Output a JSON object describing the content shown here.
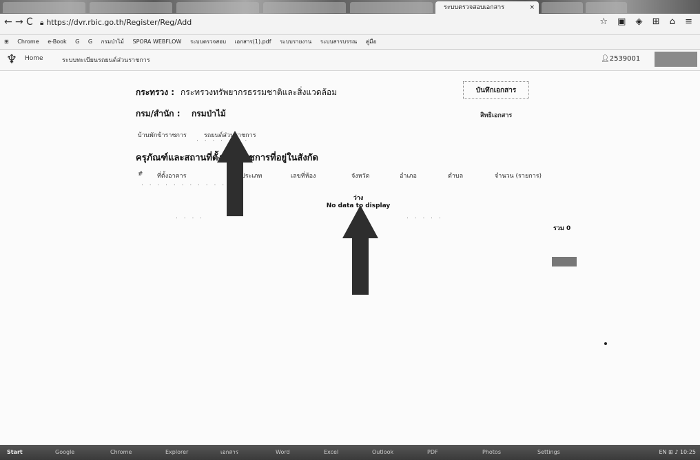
{
  "browser": {
    "active_tab_title": "ระบบตรวจสอบเอกสาร",
    "tab_close": "×",
    "url": "https://dvr.rbic.go.th/Register/Reg/Add",
    "bookmarks": [
      "Chrome",
      "e-Book",
      "G",
      "G",
      "กรมป่าไม้",
      "SPORA WEBFLOW",
      "ระบบตรวจสอบ",
      "เอกสาร(1).pdf",
      "ระบบรายงาน",
      "ระบบสารบรรณ",
      "คู่มือ"
    ],
    "ext_icons": "☆ ▣ ◈ ⊞ ⌂ ≡"
  },
  "header": {
    "home": "Home",
    "system_title": "ระบบทะเบียนรถยนต์ส่วนราชการ",
    "user_id": "2539001"
  },
  "form": {
    "ministry_label": "กระทรวง :",
    "ministry_value": "กระทรวงทรัพยากรธรรมชาติและสิ่งแวดล้อม",
    "department_label": "กรม/สำนัก :",
    "department_value": "กรมป่าไม้",
    "save_button": "บันทึกเอกสาร",
    "doc_rights": "สิทธิเอกสาร",
    "tab_1": "บ้านพักข้าราชการ",
    "tab_2": "รถยนต์ส่วนราชการ"
  },
  "section": {
    "title": "ครุภัณฑ์และสถานที่ตั้งส่วนราชการที่อยู่ในสังกัด"
  },
  "table": {
    "columns": [
      "#",
      "ที่ตั้งอาคาร",
      "ประเภท",
      "เลขที่ห้อง",
      "จังหวัด",
      "อำเภอ",
      "ตำบล",
      "จำนวน (รายการ)"
    ],
    "empty_label": "ว่าง",
    "empty_message": "No data to display",
    "total_label": "รวม 0"
  },
  "taskbar": {
    "start": "Start",
    "tasks": [
      "Google",
      "Chrome",
      "Explorer",
      "เอกสาร",
      "Word",
      "Excel",
      "Outlook",
      "PDF",
      "Photos",
      "Settings"
    ],
    "tray": "EN ⊞ ♪ 10:25"
  }
}
